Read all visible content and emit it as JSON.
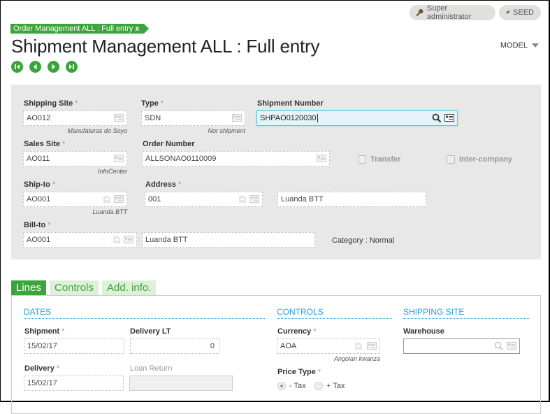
{
  "topbar": {
    "user_label": "Super administrator",
    "folder_label": "SEED"
  },
  "breadcrumb": {
    "label": "Order Management ALL : Full entry",
    "close": "x"
  },
  "page": {
    "title": "Shipment Management ALL : Full entry",
    "model_label": "MODEL"
  },
  "nav": [
    "first-record",
    "previous-record",
    "next-record",
    "last-record"
  ],
  "header": {
    "shipping_site": {
      "label": "Shipping Site",
      "value": "AO012",
      "desc": "Manufaturas do Soyo"
    },
    "type": {
      "label": "Type",
      "value": "SDN",
      "desc": "Nor shipment"
    },
    "shipment_number": {
      "label": "Shipment Number",
      "value": "SHPAO0120030"
    },
    "sales_site": {
      "label": "Sales Site",
      "value": "AO011",
      "desc": "InfoCenter"
    },
    "order_number": {
      "label": "Order Number",
      "value": "ALLSONAO0110009"
    },
    "transfer": {
      "label": "Transfer",
      "checked": false
    },
    "inter_company": {
      "label": "Inter-company",
      "checked": false
    },
    "ship_to": {
      "label": "Ship-to",
      "value": "AO001",
      "desc": "Luanda BTT"
    },
    "address": {
      "label": "Address",
      "value": "001",
      "desc_value": "Luanda BTT"
    },
    "bill_to": {
      "label": "Bill-to",
      "value": "AO001",
      "name_value": "Luanda BTT"
    },
    "category": "Category : Normal",
    "required_mark": "*"
  },
  "tabs": [
    {
      "label": "Lines",
      "active": true
    },
    {
      "label": "Controls",
      "active": false
    },
    {
      "label": "Add. info.",
      "active": false
    }
  ],
  "lines": {
    "dates": {
      "title": "DATES",
      "shipment": {
        "label": "Shipment",
        "value": "15/02/17"
      },
      "delivery_lt": {
        "label": "Delivery LT",
        "value": "0"
      },
      "delivery": {
        "label": "Delivery",
        "value": "15/02/17"
      },
      "loan_return": {
        "label": "Loan Return",
        "value": ""
      }
    },
    "controls": {
      "title": "CONTROLS",
      "currency": {
        "label": "Currency",
        "value": "AOA",
        "desc": "Angolan kwanza"
      },
      "price_type": {
        "label": "Price Type",
        "options": [
          "- Tax",
          "+ Tax"
        ],
        "selected": "- Tax"
      }
    },
    "shipping_site": {
      "title": "SHIPPING SITE",
      "warehouse": {
        "label": "Warehouse",
        "value": ""
      }
    }
  },
  "colors": {
    "accent_green": "#3aa53a",
    "section_blue": "#29a0d8",
    "focus_blue": "#5ac8e8"
  }
}
